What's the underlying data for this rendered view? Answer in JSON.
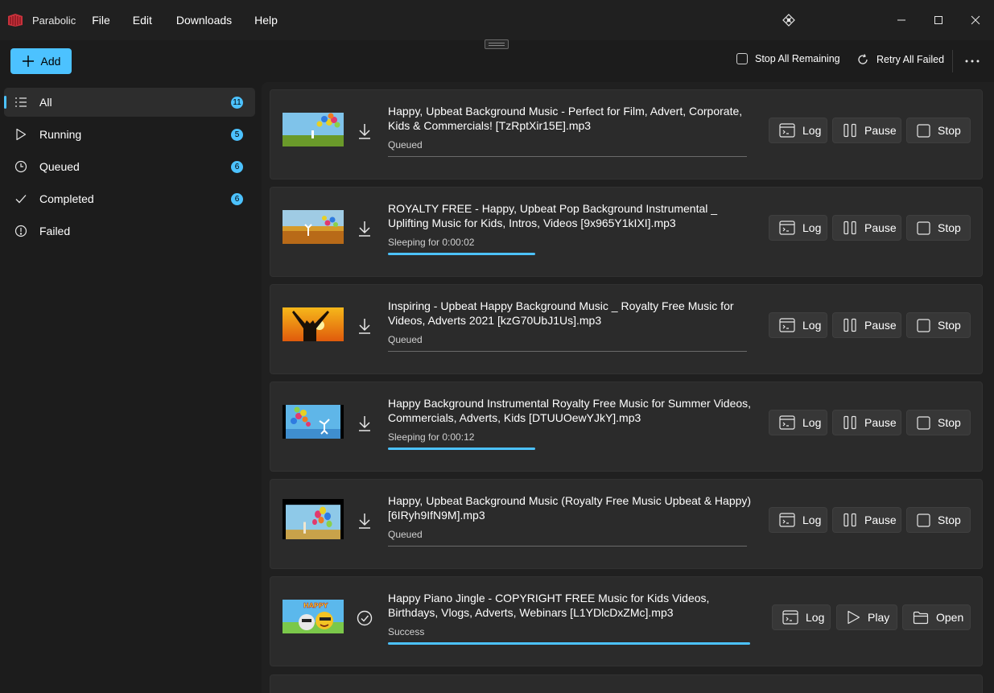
{
  "titlebar": {
    "app_name": "Parabolic",
    "menu": [
      "File",
      "Edit",
      "Downloads",
      "Help"
    ]
  },
  "toolbar": {
    "add_label": "Add",
    "stop_all_label": "Stop All Remaining",
    "retry_all_label": "Retry All Failed"
  },
  "sidebar": {
    "items": [
      {
        "label": "All",
        "badge": "11",
        "icon": "list-icon"
      },
      {
        "label": "Running",
        "badge": "5",
        "icon": "play-icon"
      },
      {
        "label": "Queued",
        "badge": "6",
        "icon": "clock-icon"
      },
      {
        "label": "Completed",
        "badge": "6",
        "icon": "check-icon"
      },
      {
        "label": "Failed",
        "badge": "",
        "icon": "alert-icon"
      }
    ]
  },
  "downloads": [
    {
      "title": "Happy, Upbeat Background Music - Perfect for Film, Advert, Corporate, Kids & Commercials! [TzRptXir15E].mp3",
      "status": "Queued",
      "progress": 0,
      "state": "queued",
      "actions": [
        "Log",
        "Pause",
        "Stop"
      ]
    },
    {
      "title": "ROYALTY FREE - Happy, Upbeat Pop Background Instrumental _ Uplifting Music for Kids, Intros, Videos [9x965Y1kIXI].mp3",
      "status": "Sleeping for 0:00:02",
      "progress": 0.41,
      "state": "running",
      "actions": [
        "Log",
        "Pause",
        "Stop"
      ]
    },
    {
      "title": "Inspiring - Upbeat Happy Background Music _ Royalty Free Music for Videos, Adverts 2021 [kzG70UbJ1Us].mp3",
      "status": "Queued",
      "progress": 0,
      "state": "queued",
      "actions": [
        "Log",
        "Pause",
        "Stop"
      ]
    },
    {
      "title": "Happy Background Instrumental Royalty Free Music for Summer Videos, Commercials, Adverts, Kids [DTUUOewYJkY].mp3",
      "status": "Sleeping for 0:00:12",
      "progress": 0.41,
      "state": "running",
      "actions": [
        "Log",
        "Pause",
        "Stop"
      ]
    },
    {
      "title": "Happy, Upbeat Background Music (Royalty Free Music Upbeat & Happy) [6IRyh9IfN9M].mp3",
      "status": "Queued",
      "progress": 0,
      "state": "queued",
      "actions": [
        "Log",
        "Pause",
        "Stop"
      ]
    },
    {
      "title": "Happy Piano Jingle - COPYRIGHT FREE Music for Kids Videos, Birthdays, Vlogs, Adverts, Webinars [L1YDlcDxZMc].mp3",
      "status": "Success",
      "progress": 1,
      "state": "success",
      "actions": [
        "Log",
        "Play",
        "Open"
      ],
      "thumb_text": "HAPPY"
    }
  ],
  "colors": {
    "accent": "#4cc2ff",
    "background": "#202020",
    "card": "#2b2b2b"
  }
}
